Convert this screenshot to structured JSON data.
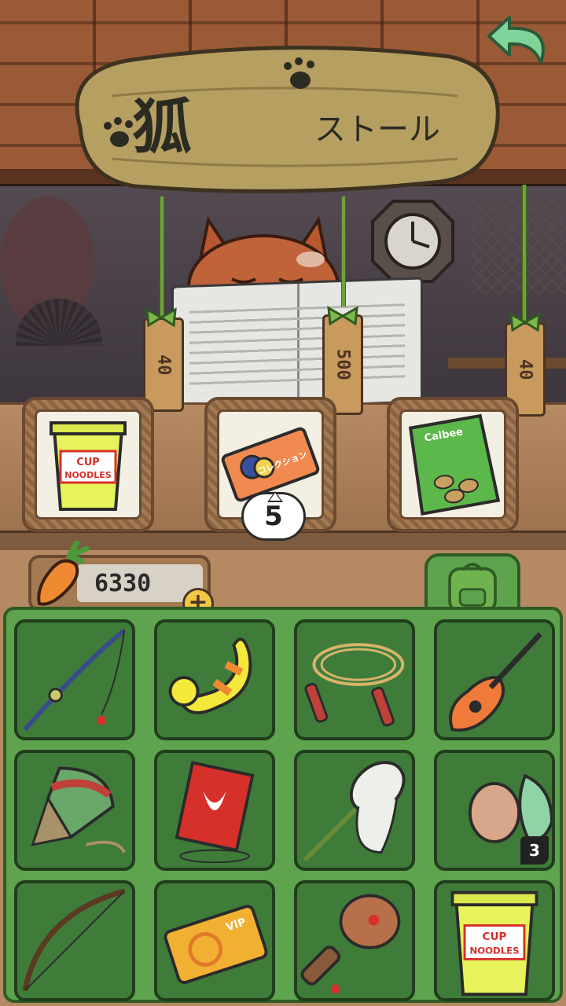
{
  "shop": {
    "sign_title": "狐",
    "sign_subtitle": "ストール",
    "items": [
      {
        "name": "cup-noodles",
        "label_top": "CUP",
        "label_bottom": "NOODLES",
        "price": "40"
      },
      {
        "name": "collection-ticket",
        "label": "コレクション",
        "price": "500",
        "stock": "5"
      },
      {
        "name": "snack-bag",
        "label": "Calbee",
        "price": "40"
      }
    ]
  },
  "wallet": {
    "carrots": "6330",
    "add_label": "+"
  },
  "inventory": {
    "slots": [
      {
        "item": "fishing-rod"
      },
      {
        "item": "duck-float"
      },
      {
        "item": "jump-rope"
      },
      {
        "item": "guitar"
      },
      {
        "item": "spinning-top"
      },
      {
        "item": "kite"
      },
      {
        "item": "butterfly-net"
      },
      {
        "item": "eggs",
        "count": "3"
      },
      {
        "item": "bow"
      },
      {
        "item": "vip-ticket",
        "label": "VIP"
      },
      {
        "item": "paddle"
      },
      {
        "item": "cup-noodles",
        "label_top": "CUP",
        "label_bottom": "NOODLES"
      }
    ]
  },
  "colors": {
    "inventory_green": "#5ea34d",
    "slot_green": "#3f7c3a",
    "wood": "#b58a63",
    "carrot_orange": "#f08a32"
  }
}
